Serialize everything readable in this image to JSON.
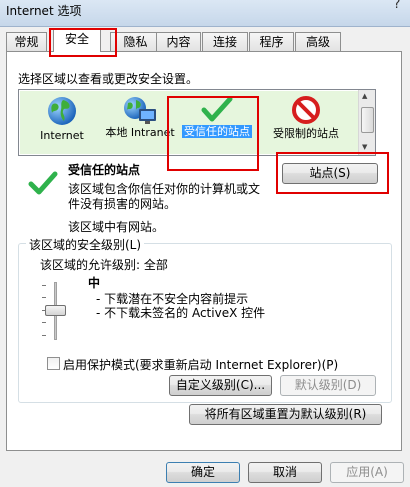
{
  "window": {
    "title": "Internet 选项",
    "help_glyph": "?"
  },
  "tabs": [
    {
      "label": "常规"
    },
    {
      "label": "安全"
    },
    {
      "label": "隐私"
    },
    {
      "label": "内容"
    },
    {
      "label": "连接"
    },
    {
      "label": "程序"
    },
    {
      "label": "高级"
    }
  ],
  "active_tab": "安全",
  "security": {
    "select_zone_text": "选择区域以查看或更改安全设置。",
    "zones": [
      {
        "label": "Internet",
        "icon": "globe-icon"
      },
      {
        "label": "本地 Intranet",
        "icon": "intranet-icon"
      },
      {
        "label": "受信任的站点",
        "icon": "checkmark-icon",
        "selected": true
      },
      {
        "label": "受限制的站点",
        "icon": "no-entry-icon"
      }
    ],
    "zone_detail": {
      "title": "受信任的站点",
      "description": "该区域包含你信任对你的计算机或文件没有损害的网站。",
      "sites_note": "该区域中有网站。",
      "sites_button": "站点(S)"
    },
    "level_group": {
      "title": "该区域的安全级别(L)",
      "allowed_levels": "该区域的允许级别: 全部",
      "level_name": "中",
      "bullets": [
        "- 下载潜在不安全内容前提示",
        "- 不下载未签名的 ActiveX 控件"
      ],
      "slider_level": 2,
      "slider_steps": 5,
      "protected_mode_label": "启用保护模式(要求重新启动 Internet Explorer)(P)",
      "protected_mode_checked": false,
      "custom_level_button": "自定义级别(C)...",
      "default_level_button": "默认级别(D)"
    },
    "reset_all_button": "将所有区域重置为默认级别(R)"
  },
  "footer": {
    "ok_button": "确定",
    "cancel_button": "取消",
    "apply_button": "应用(A)"
  },
  "colors": {
    "highlight_red": "#e00000",
    "zone_background": "#e6f6dd",
    "selection_blue": "#3399ff"
  }
}
